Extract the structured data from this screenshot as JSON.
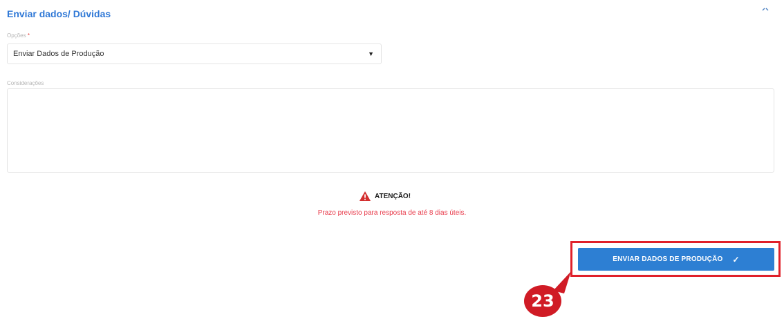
{
  "form": {
    "title": "Enviar dados/ Dúvidas",
    "options_label": "Opções",
    "required_marker": "*",
    "selected_option": "Enviar Dados de Produção",
    "considerations_label": "Considerações",
    "considerations_value": ""
  },
  "warning": {
    "title": "ATENÇÃO!",
    "message": "Prazo previsto para resposta de até 8 dias úteis."
  },
  "actions": {
    "submit_label": "ENVIAR DADOS DE PRODUÇÃO"
  },
  "annotation": {
    "step_number": "23"
  },
  "icons": {
    "collapse": "collapse-icon",
    "dropdown": "caret-down-icon",
    "warning": "warning-triangle-icon",
    "submit": "check-icon"
  },
  "colors": {
    "accent": "#2d7fd3",
    "title": "#2f78d6",
    "warning_text": "#e83a4a",
    "highlight": "#e0202a"
  }
}
